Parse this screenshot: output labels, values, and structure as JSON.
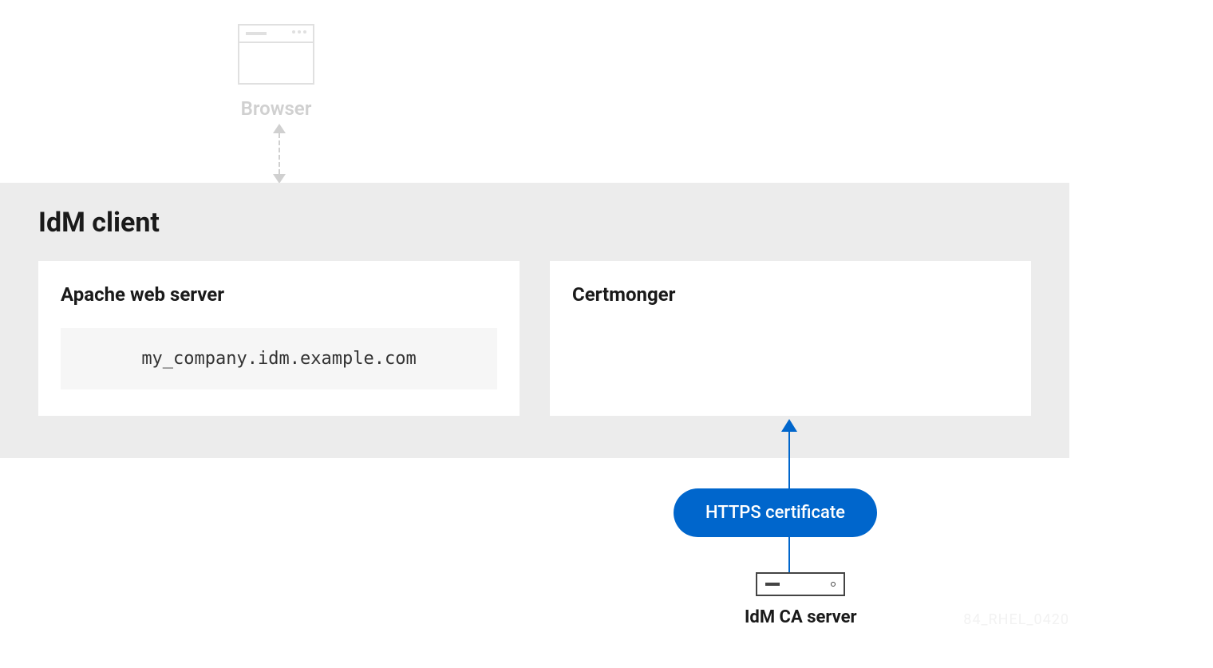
{
  "browser": {
    "label": "Browser"
  },
  "idm_client": {
    "title": "IdM client",
    "apache": {
      "title": "Apache web server",
      "hostname": "my_company.idm.example.com"
    },
    "certmonger": {
      "title": "Certmonger"
    }
  },
  "connection": {
    "cert_label": "HTTPS certificate"
  },
  "ca_server": {
    "label": "IdM CA server"
  },
  "watermark": "84_RHEL_0420",
  "colors": {
    "accent": "#0066cc",
    "muted": "#d0d0d0",
    "panel": "#ececec"
  }
}
